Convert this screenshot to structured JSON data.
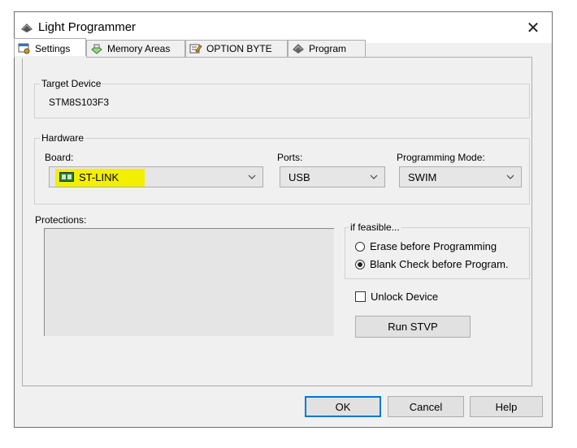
{
  "window": {
    "title": "Light Programmer"
  },
  "tabs": [
    {
      "label": "Settings",
      "icon": "settings-icon"
    },
    {
      "label": "Memory Areas",
      "icon": "memory-icon"
    },
    {
      "label": "OPTION BYTE",
      "icon": "option-byte-icon"
    },
    {
      "label": "Program",
      "icon": "chip-icon"
    }
  ],
  "target_device": {
    "group_label": "Target Device",
    "value": "STM8S103F3"
  },
  "hardware": {
    "group_label": "Hardware",
    "board_label": "Board:",
    "board_value": "ST-LINK",
    "ports_label": "Ports:",
    "ports_value": "USB",
    "mode_label": "Programming Mode:",
    "mode_value": "SWIM"
  },
  "protections": {
    "label": "Protections:"
  },
  "if_feasible": {
    "group_label": "if feasible...",
    "erase_label": "Erase before Programming",
    "blank_label": "Blank Check before Program.",
    "selected": "blank"
  },
  "unlock": {
    "label": "Unlock Device",
    "checked": false
  },
  "run_stvp": {
    "label": "Run STVP"
  },
  "footer": {
    "ok_label": "OK",
    "cancel_label": "Cancel",
    "help_label": "Help"
  },
  "colors": {
    "highlight": "#f2f000",
    "default_button_border": "#0078d7"
  }
}
